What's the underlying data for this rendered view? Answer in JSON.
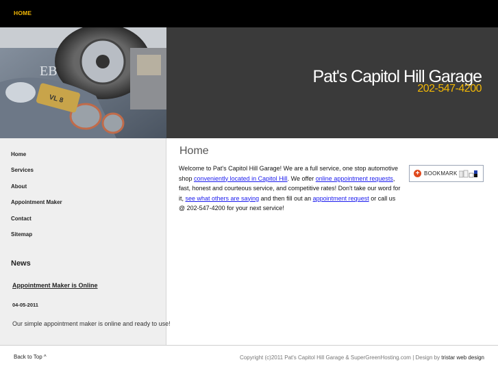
{
  "topnav": {
    "home_label": "HOME"
  },
  "header": {
    "title": "Pat's Capitol Hill Garage",
    "phone": "202-547-4200"
  },
  "sidebar": {
    "items": [
      {
        "label": "Home"
      },
      {
        "label": "Services"
      },
      {
        "label": "About"
      },
      {
        "label": "Appointment Maker"
      },
      {
        "label": "Contact"
      },
      {
        "label": "Sitemap"
      }
    ],
    "news": {
      "title": "News",
      "headline": "Appointment Maker is Online",
      "date": "04-05-2011",
      "text": "Our simple appointment maker is online and ready to use!"
    }
  },
  "main": {
    "title": "Home",
    "body": {
      "p1": "Welcome to Pat's Capitol Hill Garage! We are a full service, one stop automotive shop ",
      "link1": "conveniently located in Capitol Hill",
      "p2": ". We offer ",
      "link2": "online appointment requests",
      "p3": ", fast, honest and courteous service, and competitive rates! Don't take our word for it, ",
      "link3": "see what others are saying",
      "p4": " and then fill out an ",
      "link4": "appointment request",
      "p5": " or call us @ 202-547-4200 for your next service!"
    },
    "bookmark_label": "BOOKMARK"
  },
  "footer": {
    "back_to_top": "Back to Top ^",
    "copyright": "Copyright (c)2011 Pat's Capitol Hill Garage & SuperGreenHosting.com | Design by ",
    "designer": "tristar web design"
  },
  "colors": {
    "accent": "#f2b705",
    "header_band": "#3a3a3a",
    "topbar": "#000000",
    "link": "#1a1aee"
  }
}
